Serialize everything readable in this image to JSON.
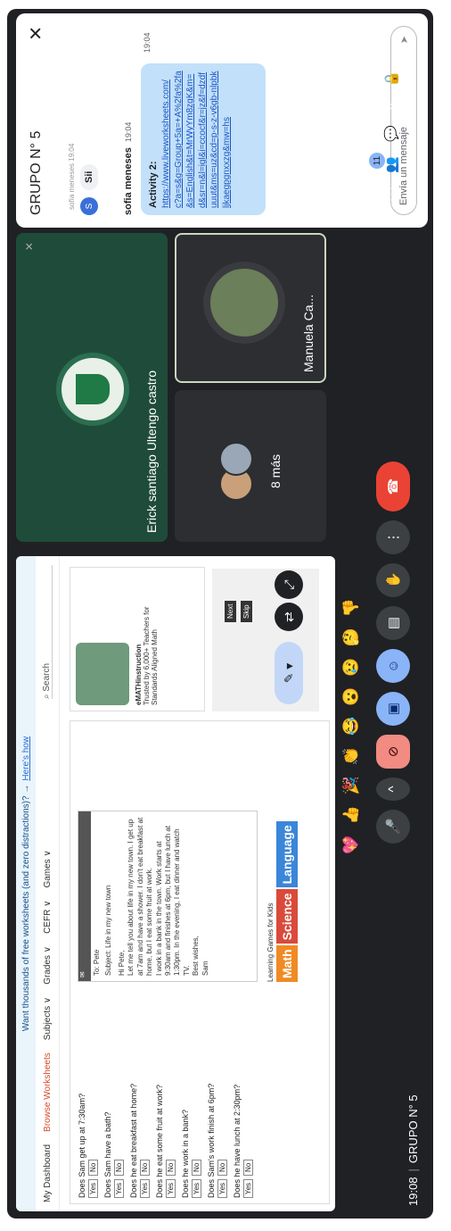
{
  "meeting": {
    "time": "19:08",
    "name": "GRUPO N° 5"
  },
  "shared": {
    "banner_text": "Want thousands of free worksheets (and zero distractions)? →",
    "banner_link": "Here's how",
    "nav": [
      "My Dashboard",
      "Browse Worksheets",
      "Subjects ∨",
      "Grades ∨",
      "CEFR ∨",
      "Games ∨"
    ],
    "search_placeholder": "Search",
    "questions": [
      "Does Sam get up at 7:30am?",
      "Does Sam have a bath?",
      "Does he eat breakfast at home?",
      "Does he eat some fruit at work?",
      "Does he work in a bank?",
      "Does Sam's work finish at 6pm?",
      "Does he have lunch at 2:30pm?"
    ],
    "yes": "Yes",
    "no": "No",
    "email": {
      "to": "To: Pete",
      "subject": "Subject: Life in my new town",
      "body": "Hi Pete,\nLet me tell you about life in my new town. I get up at 7am and have a shower. I don't eat breakfast at home, but I eat some fruit at work.\nI work in a bank in the town. Work starts at 9:30am and finishes at 6pm, but I have lunch at 1:30pm. In the evening, I eat dinner and watch TV.\nBest wishes,\nSam"
    },
    "learning_games": "Learning Games for Kids",
    "tabs": [
      "Math",
      "Science",
      "Language"
    ],
    "tab_colors": [
      "#f08a24",
      "#d94a3b",
      "#3a86d8"
    ],
    "side_card_title": "eMATHinstruction",
    "side_card_text": "Trusted by 6,000+ Teachers for Standards Aligned Math",
    "next": "Next",
    "skip": "Skip"
  },
  "participants": {
    "erick": "Erick santiago Ultengo castro",
    "more": "8 más",
    "manuela": "Manuela Ca..."
  },
  "chat": {
    "title": "GRUPO N° 5",
    "prev_snippet": "sofía meneses 19:04",
    "si_initial": "S",
    "si_message": "Sii",
    "sender": "sofia meneses",
    "sender_time": "19:04",
    "activity": "Activity 2:",
    "url": "https://www.liveworksheets.com/c?a=s&g=Group+5a=+A%2fa%2fa&s=English&t=MrWyYm8zgK&m=d&sr=n&l=igl&i=ccocf&r=jz&f=dzdfuuut&ms=uz&cd=p-s-z-v6gb-nlpbkljkaegpgnxxzg&mw=hs",
    "message_time": "19:04",
    "input_placeholder": "Envía un mensaje"
  },
  "toolbar": {
    "reactions": [
      "💖",
      "👍",
      "🎉",
      "👏",
      "😂",
      "😮",
      "😢",
      "🤔",
      "👎"
    ],
    "badge": "11"
  }
}
